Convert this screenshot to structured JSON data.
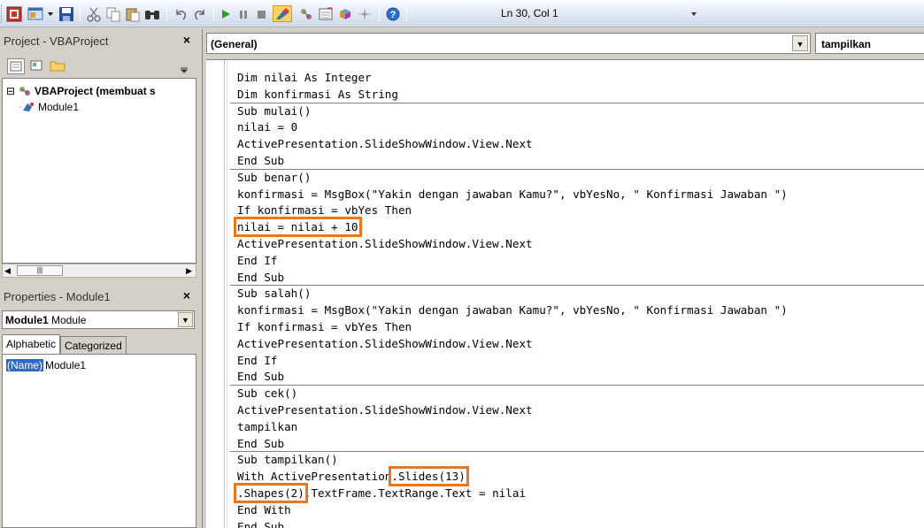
{
  "toolbar": {
    "status": "Ln 30, Col 1",
    "buttons": [
      {
        "name": "view-powerpoint-icon",
        "color": "#c0392b"
      },
      {
        "name": "insert-module-icon",
        "color": "#3a6fb0"
      },
      {
        "name": "save-icon",
        "color": "#2a4f9a"
      },
      {
        "name": "cut-icon",
        "color": "#777"
      },
      {
        "name": "copy-icon",
        "color": "#777"
      },
      {
        "name": "paste-icon",
        "color": "#777"
      },
      {
        "name": "find-icon",
        "color": "#333"
      },
      {
        "name": "undo-icon",
        "color": "#555"
      },
      {
        "name": "redo-icon",
        "color": "#555"
      },
      {
        "name": "run-icon",
        "color": "#2aa02a"
      },
      {
        "name": "break-icon",
        "color": "#777"
      },
      {
        "name": "reset-icon",
        "color": "#777"
      },
      {
        "name": "design-mode-icon",
        "color": "#e0a800"
      },
      {
        "name": "project-explorer-icon",
        "color": "#666"
      },
      {
        "name": "properties-window-icon",
        "color": "#666"
      },
      {
        "name": "object-browser-icon",
        "color": "#666"
      },
      {
        "name": "toolbox-icon",
        "color": "#666"
      },
      {
        "name": "help-icon",
        "color": "#2a6fd0"
      }
    ]
  },
  "project_pane": {
    "title": "Project - VBAProject",
    "close": "×",
    "tree": [
      {
        "label": "VBAProject (membuat s",
        "icon": "vba-project-icon",
        "expander": "⊟"
      },
      {
        "label": "Module1",
        "icon": "module-icon"
      }
    ]
  },
  "properties_pane": {
    "title": "Properties - Module1",
    "close": "×",
    "object_name": "Module1",
    "object_type": "Module",
    "tabs": [
      "Alphabetic",
      "Categorized"
    ],
    "active_tab": "Alphabetic",
    "rows": [
      {
        "key": "(Name)",
        "value": "Module1"
      }
    ]
  },
  "code_window": {
    "object_combo": "(General)",
    "procedure_combo": "tampilkan",
    "lines": [
      "Dim nilai As Integer",
      "Dim konfirmasi As String",
      "Sub mulai()",
      "nilai = 0",
      "ActivePresentation.SlideShowWindow.View.Next",
      "End Sub",
      "Sub benar()",
      "konfirmasi = MsgBox(\"Yakin dengan jawaban Kamu?\", vbYesNo, \" Konfirmasi Jawaban \")",
      "If konfirmasi = vbYes Then",
      "nilai = nilai + 10",
      "ActivePresentation.SlideShowWindow.View.Next",
      "End If",
      "End Sub",
      "Sub salah()",
      "konfirmasi = MsgBox(\"Yakin dengan jawaban Kamu?\", vbYesNo, \" Konfirmasi Jawaban \")",
      "If konfirmasi = vbYes Then",
      "ActivePresentation.SlideShowWindow.View.Next",
      "End If",
      "End Sub",
      "Sub cek()",
      "ActivePresentation.SlideShowWindow.View.Next",
      "tampilkan",
      "End Sub",
      "Sub tampilkan()",
      "With ActivePresentation.Slides(13)",
      ".Shapes(2).TextFrame.TextRange.Text = nilai",
      "End With",
      "End Sub"
    ],
    "highlight_color": "#e87722"
  }
}
